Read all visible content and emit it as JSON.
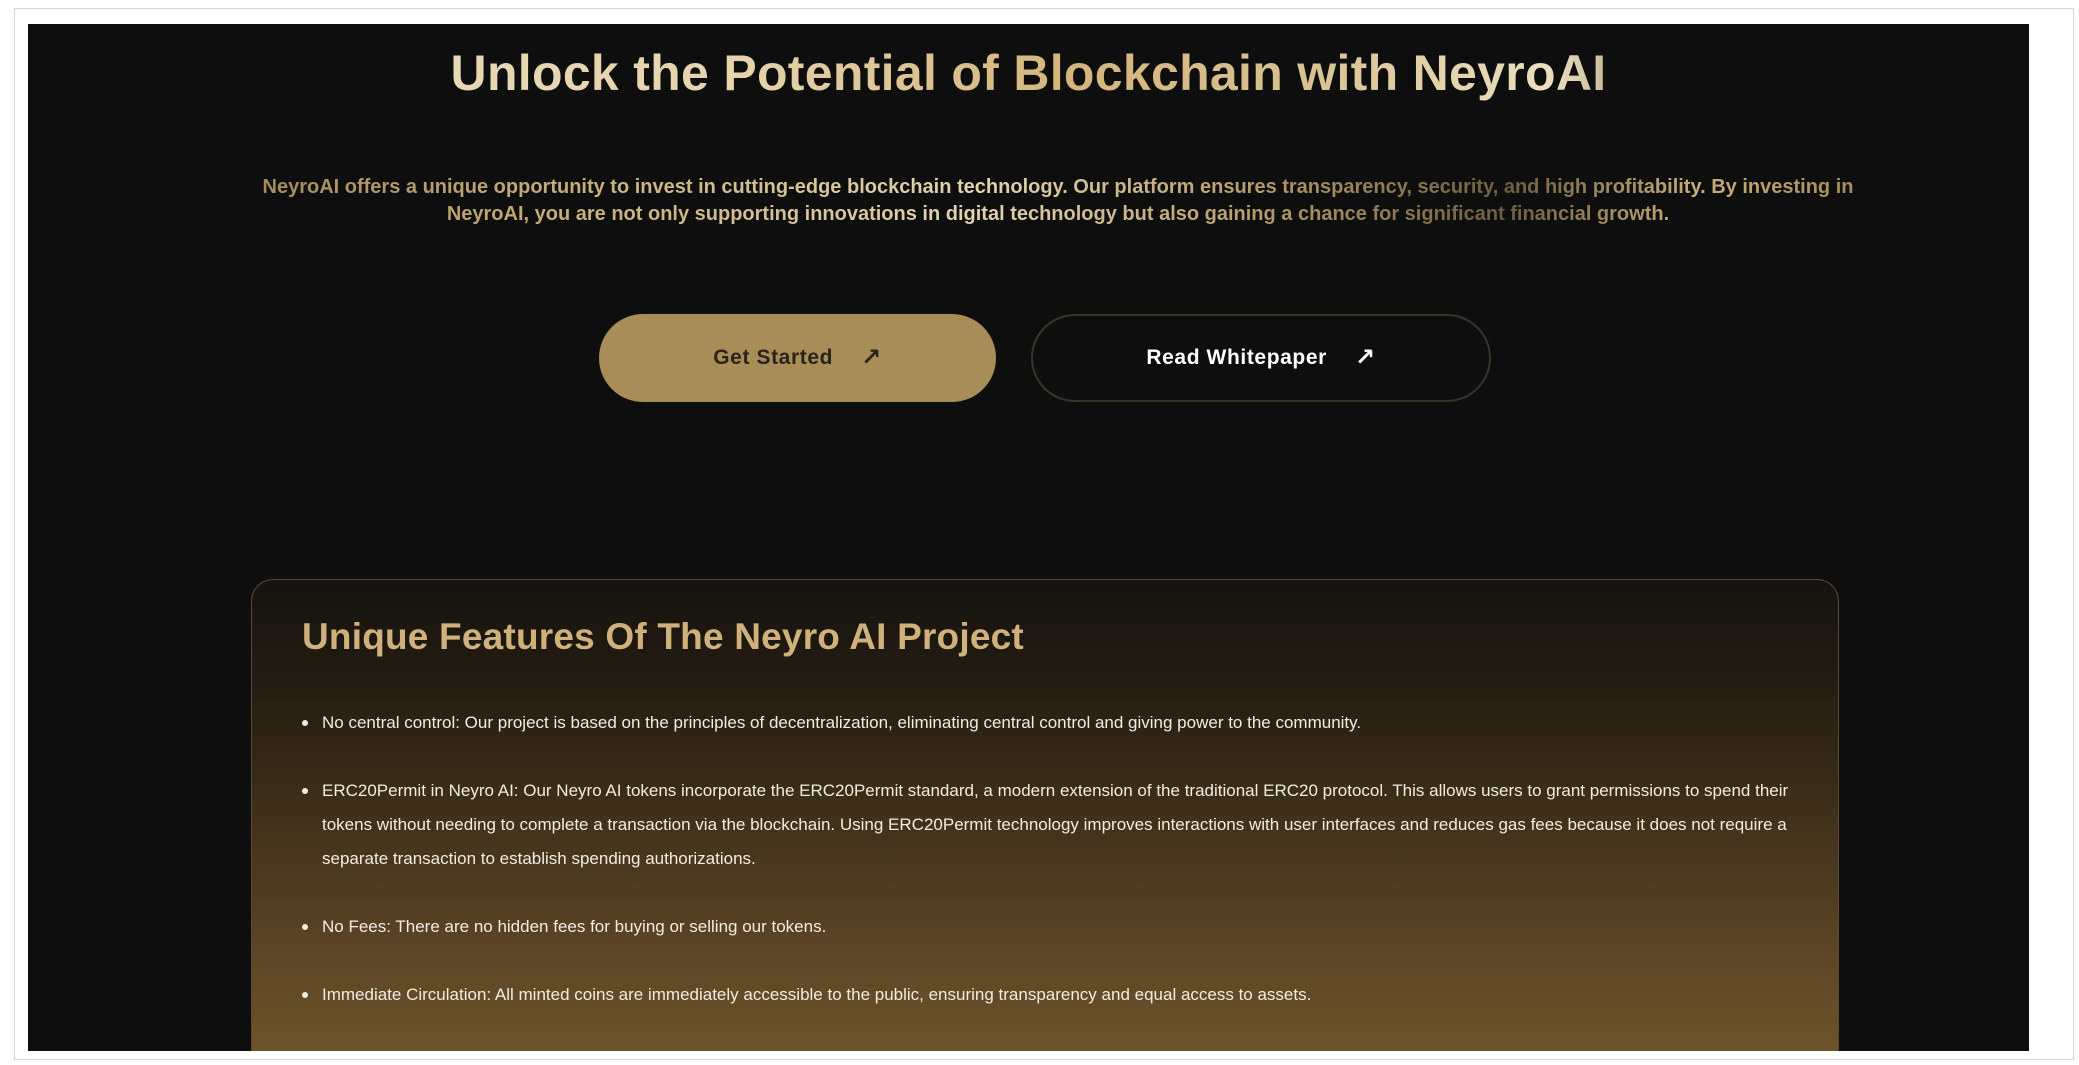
{
  "hero": {
    "title": "Unlock the Potential of Blockchain with NeyroAI",
    "description": "NeyroAI offers a unique opportunity to invest in cutting-edge blockchain technology. Our platform ensures transparency, security, and high profitability. By investing in NeyroAI, you are not only supporting innovations in digital technology but also gaining a chance for significant financial growth."
  },
  "actions": {
    "get_started": {
      "label": "Get Started",
      "icon": "arrow-up-right-icon"
    },
    "read_whitepaper": {
      "label": "Read Whitepaper",
      "icon": "arrow-up-right-icon"
    }
  },
  "features": {
    "title": "Unique Features Of The Neyro AI Project",
    "items": [
      "No central control: Our project is based on the principles of decentralization, eliminating central control and giving power to the community.",
      "ERC20Permit in Neyro AI: Our Neyro AI tokens incorporate the ERC20Permit standard, a modern extension of the traditional ERC20 protocol. This allows users to grant permissions to spend their tokens without needing to complete a transaction via the blockchain. Using ERC20Permit technology improves interactions with user interfaces and reduces gas fees because it does not require a separate transaction to establish spending authorizations.",
      "No Fees: There are no hidden fees for buying or selling our tokens.",
      "Immediate Circulation: All minted coins are immediately accessible to the public, ensuring transparency and equal access to assets."
    ]
  },
  "colors": {
    "background": "#0e0e0e",
    "accent_gold": "#a88d59",
    "heading_gold": "#cfb27b",
    "text_light": "#f2ece1"
  }
}
